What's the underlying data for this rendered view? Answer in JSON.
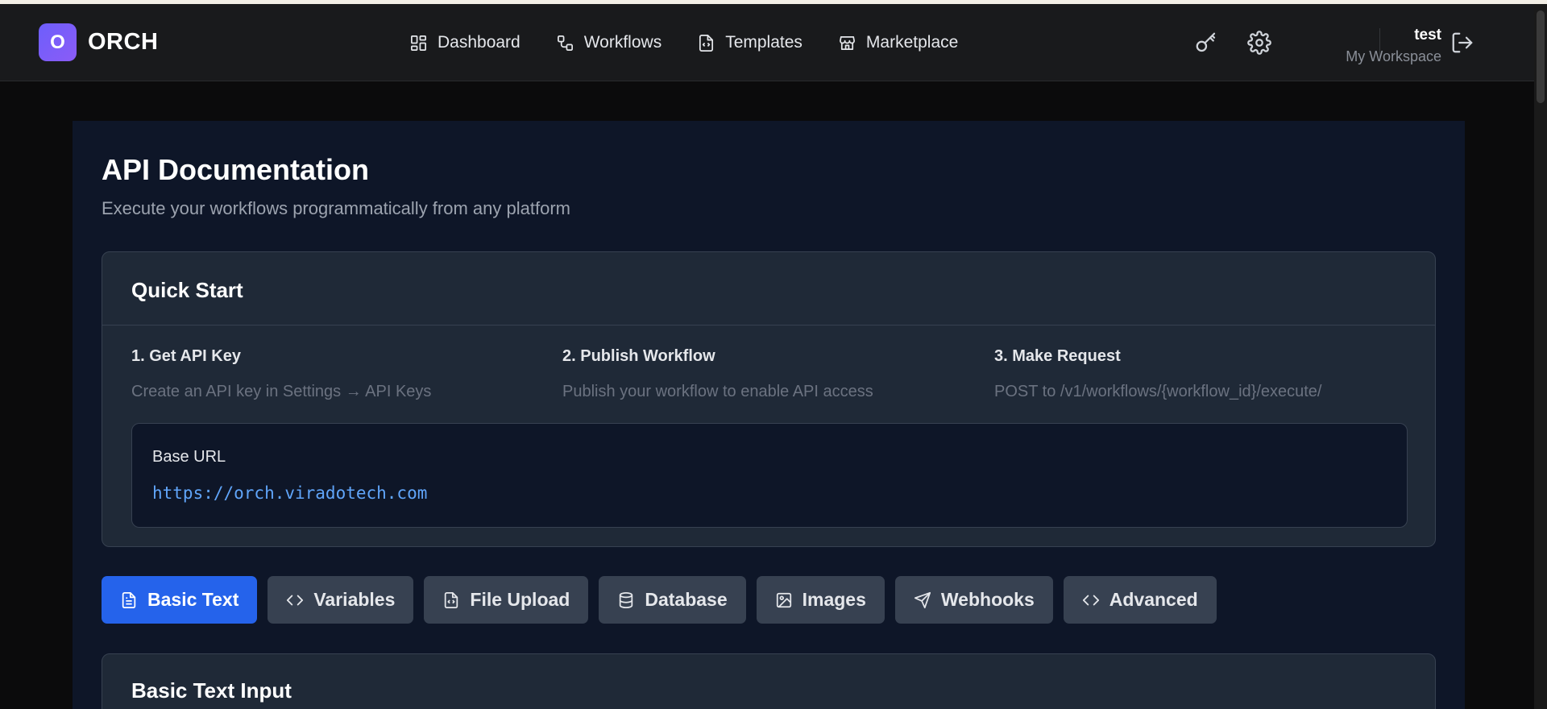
{
  "app": {
    "logo_letter": "O",
    "name": "ORCH"
  },
  "nav": {
    "links": [
      {
        "label": "Dashboard",
        "icon": "dashboard-grid-icon"
      },
      {
        "label": "Workflows",
        "icon": "workflow-icon"
      },
      {
        "label": "Templates",
        "icon": "template-file-icon"
      },
      {
        "label": "Marketplace",
        "icon": "store-icon"
      }
    ],
    "right_icons": [
      "key-icon",
      "gear-icon",
      "logout-icon"
    ]
  },
  "user": {
    "name": "test",
    "workspace": "My Workspace"
  },
  "page": {
    "title": "API Documentation",
    "subtitle": "Execute your workflows programmatically from any platform"
  },
  "quick_start": {
    "title": "Quick Start",
    "steps": [
      {
        "title": "1. Get API Key",
        "desc": "Create an API key in Settings → API Keys"
      },
      {
        "title": "2. Publish Workflow",
        "desc": "Publish your workflow to enable API access"
      },
      {
        "title": "3. Make Request",
        "desc": "POST to /v1/workflows/{workflow_id}/execute/"
      }
    ],
    "base_url_label": "Base URL",
    "base_url": "https://orch.viradotech.com"
  },
  "tabs": [
    {
      "label": "Basic Text",
      "icon": "document-icon",
      "active": true
    },
    {
      "label": "Variables",
      "icon": "code-icon",
      "active": false
    },
    {
      "label": "File Upload",
      "icon": "file-code-icon",
      "active": false
    },
    {
      "label": "Database",
      "icon": "database-icon",
      "active": false
    },
    {
      "label": "Images",
      "icon": "image-icon",
      "active": false
    },
    {
      "label": "Webhooks",
      "icon": "send-icon",
      "active": false
    },
    {
      "label": "Advanced",
      "icon": "code-icon",
      "active": false
    }
  ],
  "section": {
    "title": "Basic Text Input"
  },
  "colors": {
    "accent": "#2563eb",
    "url_color": "#60a5fa",
    "logo_gradient_start": "#6d5efc",
    "logo_gradient_end": "#8b5cf6"
  }
}
